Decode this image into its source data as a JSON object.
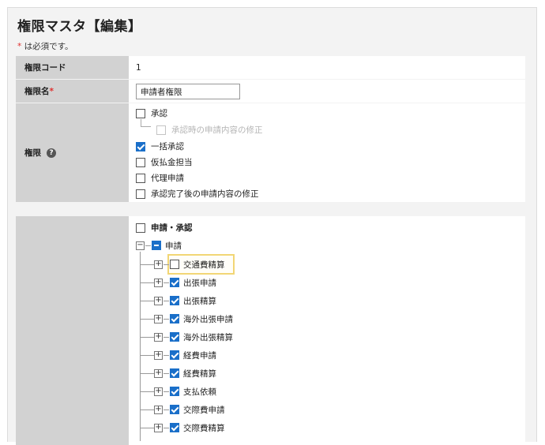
{
  "page": {
    "title": "権限マスタ【編集】",
    "required_mark": "*",
    "required_note": " は必須です。"
  },
  "fields": {
    "code": {
      "label": "権限コード",
      "value": "1"
    },
    "name": {
      "label": "権限名",
      "required_mark": "*",
      "value": "申請者権限"
    },
    "permissions": {
      "label": "権限",
      "help_icon": "question-circle-icon",
      "help_glyph": "?",
      "options": [
        {
          "label": "承認",
          "checked": false,
          "disabled": false
        },
        {
          "label": "承認時の申請内容の修正",
          "checked": false,
          "disabled": true
        },
        {
          "label": "一括承認",
          "checked": true,
          "disabled": false
        },
        {
          "label": "仮払金担当",
          "checked": false,
          "disabled": false
        },
        {
          "label": "代理申請",
          "checked": false,
          "disabled": false
        },
        {
          "label": "承認完了後の申請内容の修正",
          "checked": false,
          "disabled": false
        }
      ]
    }
  },
  "tree": {
    "root_label": "申請・承認",
    "group_label": "申請",
    "collapse_glyph": "−",
    "expand_glyph": "+",
    "items": [
      {
        "label": "交通費精算",
        "checked": false,
        "highlighted": true
      },
      {
        "label": "出張申請",
        "checked": true
      },
      {
        "label": "出張精算",
        "checked": true
      },
      {
        "label": "海外出張申請",
        "checked": true
      },
      {
        "label": "海外出張精算",
        "checked": true
      },
      {
        "label": "経費申請",
        "checked": true
      },
      {
        "label": "経費精算",
        "checked": true
      },
      {
        "label": "支払依頼",
        "checked": true
      },
      {
        "label": "交際費申請",
        "checked": true
      },
      {
        "label": "交際費精算",
        "checked": true
      }
    ]
  },
  "colors": {
    "accent": "#1a6fc9",
    "required": "#e0312f",
    "highlight": "#f2d675",
    "label_bg": "#d2d2d2"
  }
}
